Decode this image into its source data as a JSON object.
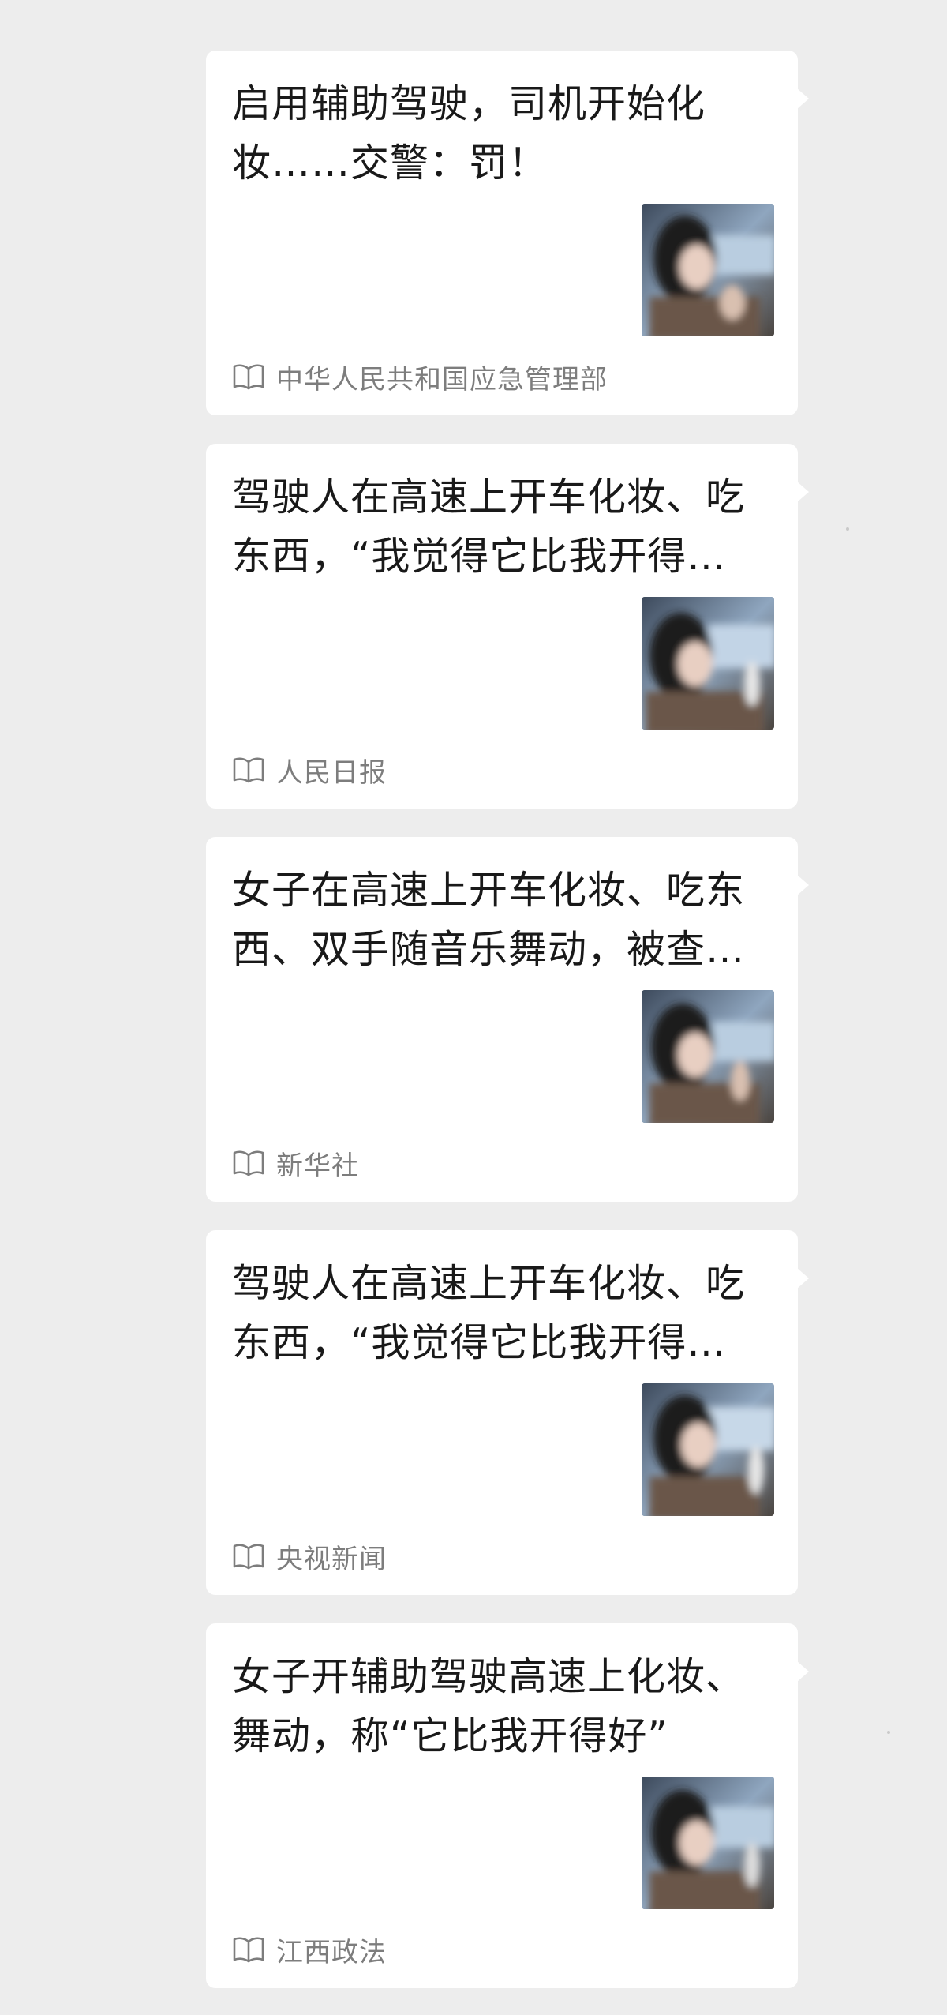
{
  "articles": [
    {
      "title": "启用辅助驾驶，司机开始化妆……交警：罚！",
      "source": "中华人民共和国应急管理部",
      "thumbnail_icon": "blurred-photo-woman-in-car"
    },
    {
      "title": "驾驶人在高速上开车化妆、吃东西，“我觉得它比我开得…",
      "source": "人民日报",
      "thumbnail_icon": "blurred-photo-woman-in-car"
    },
    {
      "title": "女子在高速上开车化妆、吃东西、双手随音乐舞动，被查…",
      "source": "新华社",
      "thumbnail_icon": "blurred-photo-woman-in-car"
    },
    {
      "title": "驾驶人在高速上开车化妆、吃东西，“我觉得它比我开得…",
      "source": "央视新闻",
      "thumbnail_icon": "blurred-photo-woman-in-car"
    },
    {
      "title": "女子开辅助驾驶高速上化妆、舞动，称“它比我开得好”",
      "source": "江西政法",
      "thumbnail_icon": "blurred-photo-woman-in-car"
    }
  ],
  "source_icon": "book-open-icon",
  "colors": {
    "background": "#ededed",
    "card": "#ffffff",
    "title_text": "#191919",
    "source_text": "#7d7d7d"
  }
}
